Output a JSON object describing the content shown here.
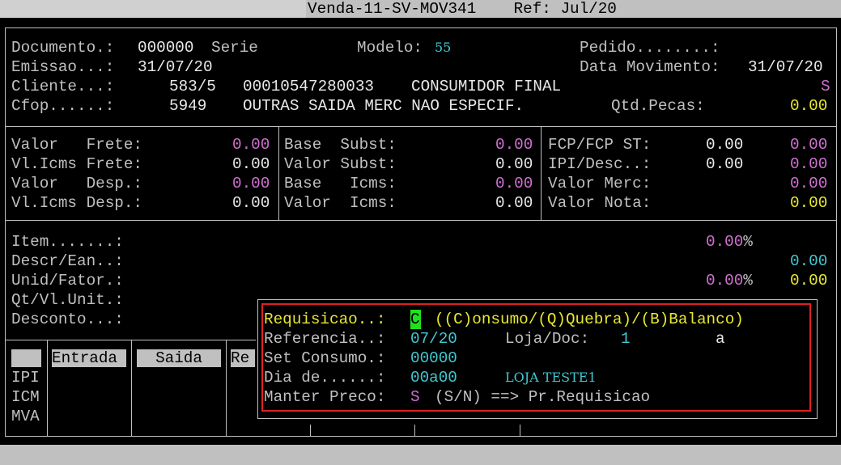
{
  "window": {
    "title": "Venda-11-SV-MOV341",
    "ref_label": "Ref:",
    "ref_value": "Jul/20"
  },
  "header": {
    "documento_label": "Documento.:",
    "documento_value": "000000",
    "serie_label": "Serie",
    "modelo_label": "Modelo:",
    "modelo_value": "55",
    "pedido_label": "Pedido........:",
    "emissao_label": "Emissao...:",
    "emissao_value": "31/07/20",
    "data_mov_label": "Data Movimento:",
    "data_mov_value": "31/07/20",
    "cliente_label": "Cliente...:",
    "cliente_code": "583/5",
    "cliente_doc": "00010547280033",
    "cliente_name": "CONSUMIDOR FINAL",
    "cliente_flag": "S",
    "cfop_label": "Cfop......:",
    "cfop_code": "5949",
    "cfop_desc": "OUTRAS SAIDA MERC NAO ESPECIF.",
    "qtd_pecas_label": "Qtd.Pecas:",
    "qtd_pecas_value": "0.00"
  },
  "totals": {
    "col1": [
      {
        "label": "Valor   Frete:",
        "value": "0.00"
      },
      {
        "label": "Vl.Icms Frete:",
        "value": "0.00"
      },
      {
        "label": "Valor   Desp.:",
        "value": "0.00"
      },
      {
        "label": "Vl.Icms Desp.:",
        "value": "0.00"
      }
    ],
    "col2": [
      {
        "label": "Base  Subst:",
        "value": "0.00"
      },
      {
        "label": "Valor Subst:",
        "value": "0.00"
      },
      {
        "label": "Base   Icms:",
        "value": "0.00"
      },
      {
        "label": "Valor  Icms:",
        "value": "0.00"
      }
    ],
    "col3": [
      {
        "label": "FCP/FCP ST:",
        "mid": "0.00",
        "value": "0.00"
      },
      {
        "label": "IPI/Desc..:",
        "mid": "0.00",
        "value": "0.00"
      },
      {
        "label": "Valor Merc:",
        "mid": "",
        "value": "0.00"
      },
      {
        "label": "Valor Nota:",
        "mid": "",
        "value": "0.00"
      }
    ]
  },
  "item": {
    "item_label": "Item.......:",
    "item_pct": "0.00",
    "pct_sign": "%",
    "descr_label": "Descr/Ean..:",
    "descr_value": "0.00",
    "unid_label": "Unid/Fator.:",
    "unid_pct": "0.00",
    "unid_value": "0.00",
    "qt_label": "Qt/Vl.Unit.:",
    "desconto_label": "Desconto...:"
  },
  "grid": {
    "entrada_label": "Entrada",
    "saida_label": "Saida",
    "re_label": "Re",
    "rows": [
      "IPI",
      "ICM",
      "MVA"
    ]
  },
  "popup": {
    "requisicao_label": "Requisicao..:",
    "requisicao_value": "C",
    "requisicao_options": "((C)onsumo/(Q)Quebra)/(B)Balanco)",
    "referencia_label": "Referencia..:",
    "referencia_value": "07/20",
    "loja_label": "Loja/Doc:",
    "loja_value": "1",
    "loja_doc": "a",
    "set_consumo_label": "Set Consumo.:",
    "set_consumo_value": "00000",
    "dia_label": "Dia de......:",
    "dia_value": "00a00",
    "loja_name": "LOJA TESTE1",
    "manter_label": "Manter Preco:",
    "manter_value": "S",
    "manter_hint": "(S/N) ==> Pr.Requisicao"
  }
}
